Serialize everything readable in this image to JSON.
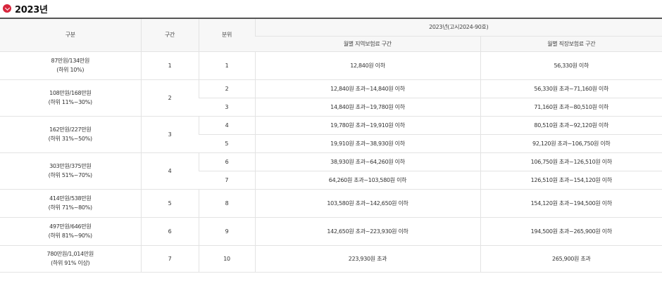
{
  "heading": {
    "icon": "red-circle-check-icon",
    "title": "2023년"
  },
  "columns": {
    "category": "구분",
    "section": "구간",
    "decile": "분위",
    "group": "2023년(고시2024-90호)",
    "regional": "월별 지역보험료 구간",
    "workplace": "월별 직장보험료 구간"
  },
  "groups": [
    {
      "category_line1": "87만원/134만원",
      "category_line2": "(하위 10%)",
      "section": "1",
      "rows": [
        {
          "decile": "1",
          "regional": "12,840원 이하",
          "workplace": "56,330원 이하"
        }
      ]
    },
    {
      "category_line1": "108만원/168만원",
      "category_line2": "(하위 11%~30%)",
      "section": "2",
      "rows": [
        {
          "decile": "2",
          "regional": "12,840원 초과~14,840원 이하",
          "workplace": "56,330원 초과~71,160원 이하"
        },
        {
          "decile": "3",
          "regional": "14,840원 초과~19,780원 이하",
          "workplace": "71,160원 초과~80,510원 이하"
        }
      ]
    },
    {
      "category_line1": "162만원/227만원",
      "category_line2": "(하위 31%~50%)",
      "section": "3",
      "rows": [
        {
          "decile": "4",
          "regional": "19,780원 초과~19,910원 이하",
          "workplace": "80,510원 초과~92,120원 이하"
        },
        {
          "decile": "5",
          "regional": "19,910원 초과~38,930원 이하",
          "workplace": "92,120원 초과~106,750원 이하"
        }
      ]
    },
    {
      "category_line1": "303만원/375만원",
      "category_line2": "(하위 51%~70%)",
      "section": "4",
      "rows": [
        {
          "decile": "6",
          "regional": "38,930원 초과~64,260원 이하",
          "workplace": "106,750원 초과~126,510원 이하"
        },
        {
          "decile": "7",
          "regional": "64,260원 초과~103,580원 이하",
          "workplace": "126,510원 초과~154,120원 이하"
        }
      ]
    },
    {
      "category_line1": "414만원/538만원",
      "category_line2": "(하위 71%~80%)",
      "section": "5",
      "rows": [
        {
          "decile": "8",
          "regional": "103,580원 초과~142,650원 이하",
          "workplace": "154,120원 초과~194,500원 이하"
        }
      ]
    },
    {
      "category_line1": "497만원/646만원",
      "category_line2": "(하위 81%~90%)",
      "section": "6",
      "rows": [
        {
          "decile": "9",
          "regional": "142,650원 초과~223,930원 이하",
          "workplace": "194,500원 초과~265,900원 이하"
        }
      ]
    },
    {
      "category_line1": "780만원/1,014만원",
      "category_line2": "(하위 91% 이상)",
      "section": "7",
      "rows": [
        {
          "decile": "10",
          "regional": "223,930원 초과",
          "workplace": "265,900원 초과"
        }
      ]
    }
  ]
}
